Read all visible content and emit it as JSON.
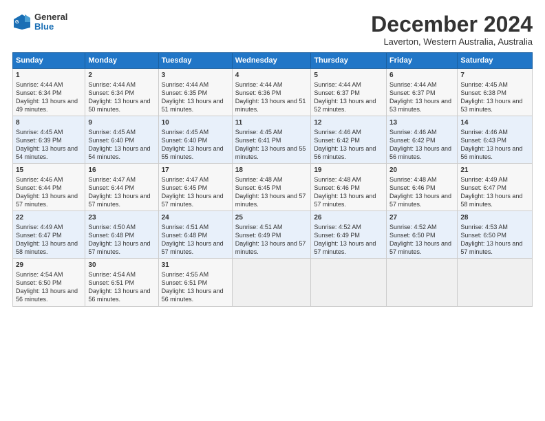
{
  "header": {
    "logo": {
      "general": "General",
      "blue": "Blue"
    },
    "title": "December 2024",
    "location": "Laverton, Western Australia, Australia"
  },
  "columns": [
    "Sunday",
    "Monday",
    "Tuesday",
    "Wednesday",
    "Thursday",
    "Friday",
    "Saturday"
  ],
  "weeks": [
    [
      {
        "day": "1",
        "sunrise": "4:44 AM",
        "sunset": "6:34 PM",
        "daylight": "13 hours and 49 minutes."
      },
      {
        "day": "2",
        "sunrise": "4:44 AM",
        "sunset": "6:34 PM",
        "daylight": "13 hours and 50 minutes."
      },
      {
        "day": "3",
        "sunrise": "4:44 AM",
        "sunset": "6:35 PM",
        "daylight": "13 hours and 51 minutes."
      },
      {
        "day": "4",
        "sunrise": "4:44 AM",
        "sunset": "6:36 PM",
        "daylight": "13 hours and 51 minutes."
      },
      {
        "day": "5",
        "sunrise": "4:44 AM",
        "sunset": "6:37 PM",
        "daylight": "13 hours and 52 minutes."
      },
      {
        "day": "6",
        "sunrise": "4:44 AM",
        "sunset": "6:37 PM",
        "daylight": "13 hours and 53 minutes."
      },
      {
        "day": "7",
        "sunrise": "4:45 AM",
        "sunset": "6:38 PM",
        "daylight": "13 hours and 53 minutes."
      }
    ],
    [
      {
        "day": "8",
        "sunrise": "4:45 AM",
        "sunset": "6:39 PM",
        "daylight": "13 hours and 54 minutes."
      },
      {
        "day": "9",
        "sunrise": "4:45 AM",
        "sunset": "6:40 PM",
        "daylight": "13 hours and 54 minutes."
      },
      {
        "day": "10",
        "sunrise": "4:45 AM",
        "sunset": "6:40 PM",
        "daylight": "13 hours and 55 minutes."
      },
      {
        "day": "11",
        "sunrise": "4:45 AM",
        "sunset": "6:41 PM",
        "daylight": "13 hours and 55 minutes."
      },
      {
        "day": "12",
        "sunrise": "4:46 AM",
        "sunset": "6:42 PM",
        "daylight": "13 hours and 56 minutes."
      },
      {
        "day": "13",
        "sunrise": "4:46 AM",
        "sunset": "6:42 PM",
        "daylight": "13 hours and 56 minutes."
      },
      {
        "day": "14",
        "sunrise": "4:46 AM",
        "sunset": "6:43 PM",
        "daylight": "13 hours and 56 minutes."
      }
    ],
    [
      {
        "day": "15",
        "sunrise": "4:46 AM",
        "sunset": "6:44 PM",
        "daylight": "13 hours and 57 minutes."
      },
      {
        "day": "16",
        "sunrise": "4:47 AM",
        "sunset": "6:44 PM",
        "daylight": "13 hours and 57 minutes."
      },
      {
        "day": "17",
        "sunrise": "4:47 AM",
        "sunset": "6:45 PM",
        "daylight": "13 hours and 57 minutes."
      },
      {
        "day": "18",
        "sunrise": "4:48 AM",
        "sunset": "6:45 PM",
        "daylight": "13 hours and 57 minutes."
      },
      {
        "day": "19",
        "sunrise": "4:48 AM",
        "sunset": "6:46 PM",
        "daylight": "13 hours and 57 minutes."
      },
      {
        "day": "20",
        "sunrise": "4:48 AM",
        "sunset": "6:46 PM",
        "daylight": "13 hours and 57 minutes."
      },
      {
        "day": "21",
        "sunrise": "4:49 AM",
        "sunset": "6:47 PM",
        "daylight": "13 hours and 58 minutes."
      }
    ],
    [
      {
        "day": "22",
        "sunrise": "4:49 AM",
        "sunset": "6:47 PM",
        "daylight": "13 hours and 58 minutes."
      },
      {
        "day": "23",
        "sunrise": "4:50 AM",
        "sunset": "6:48 PM",
        "daylight": "13 hours and 57 minutes."
      },
      {
        "day": "24",
        "sunrise": "4:51 AM",
        "sunset": "6:48 PM",
        "daylight": "13 hours and 57 minutes."
      },
      {
        "day": "25",
        "sunrise": "4:51 AM",
        "sunset": "6:49 PM",
        "daylight": "13 hours and 57 minutes."
      },
      {
        "day": "26",
        "sunrise": "4:52 AM",
        "sunset": "6:49 PM",
        "daylight": "13 hours and 57 minutes."
      },
      {
        "day": "27",
        "sunrise": "4:52 AM",
        "sunset": "6:50 PM",
        "daylight": "13 hours and 57 minutes."
      },
      {
        "day": "28",
        "sunrise": "4:53 AM",
        "sunset": "6:50 PM",
        "daylight": "13 hours and 57 minutes."
      }
    ],
    [
      {
        "day": "29",
        "sunrise": "4:54 AM",
        "sunset": "6:50 PM",
        "daylight": "13 hours and 56 minutes."
      },
      {
        "day": "30",
        "sunrise": "4:54 AM",
        "sunset": "6:51 PM",
        "daylight": "13 hours and 56 minutes."
      },
      {
        "day": "31",
        "sunrise": "4:55 AM",
        "sunset": "6:51 PM",
        "daylight": "13 hours and 56 minutes."
      },
      null,
      null,
      null,
      null
    ]
  ]
}
